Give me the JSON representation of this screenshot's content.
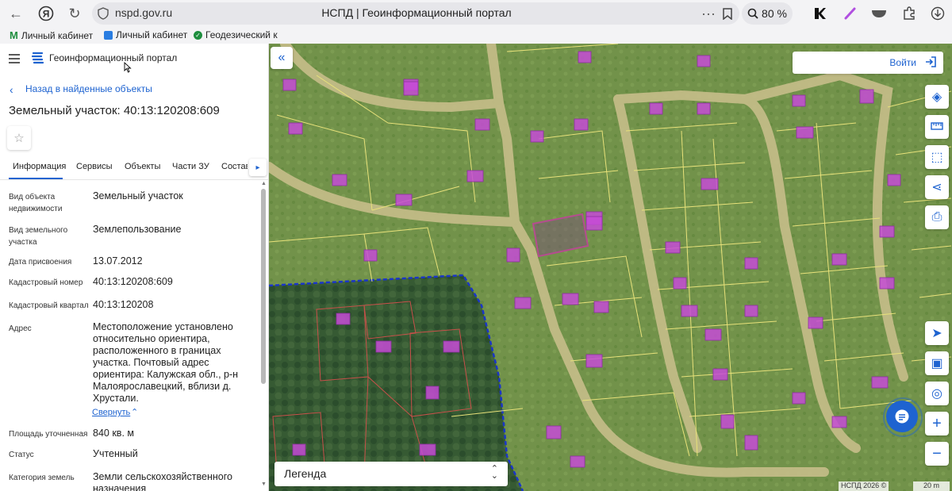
{
  "browser": {
    "url": "nspd.gov.ru",
    "title": "НСПД | Геоинформационный портал",
    "zoom": "80 %",
    "bookmarks": [
      {
        "label": "Личный кабинет"
      },
      {
        "label": "Личный кабинет"
      },
      {
        "label": "Геодезический к"
      }
    ]
  },
  "panel": {
    "portal_title": "Геоинформационный портал",
    "back_link": "Назад в найденные объекты",
    "object_title": "Земельный участок: 40:13:120208:609",
    "tabs": [
      "Информация",
      "Сервисы",
      "Объекты",
      "Части ЗУ",
      "Состав"
    ],
    "fields": [
      {
        "label": "Вид объекта\nнедвижимости",
        "value": "Земельный участок"
      },
      {
        "label": "Вид земельного\nучастка",
        "value": "Землепользование"
      },
      {
        "label": "Дата присвоения",
        "value": "13.07.2012"
      },
      {
        "label": "Кадастровый номер",
        "value": "40:13:120208:609"
      },
      {
        "label": "Кадастровый квартал",
        "value": "40:13:120208"
      },
      {
        "label": "Адрес",
        "value": "Местоположение установлено относительно ориентира, расположенного в границах участка. Почтовый адрес ориентира: Калужская обл., р-н Малоярославецкий, вблизи д. Хрустали."
      },
      {
        "label": "Площадь уточненная",
        "value": "840 кв. м"
      },
      {
        "label": "Статус",
        "value": "Учтенный"
      },
      {
        "label": "Категория земель",
        "value": "Земли сельскохозяйственного назначения"
      }
    ],
    "collapse_link": "Свернуть"
  },
  "map": {
    "login_label": "Войти",
    "legend_label": "Легенда",
    "copyright": "НСПД 2026 ©",
    "scale_label": "20 m"
  },
  "colors": {
    "accent": "#1e63d0",
    "parcel_line": "#e8e27a",
    "building": "#c64bd6",
    "boundary": "#1a35c8"
  }
}
